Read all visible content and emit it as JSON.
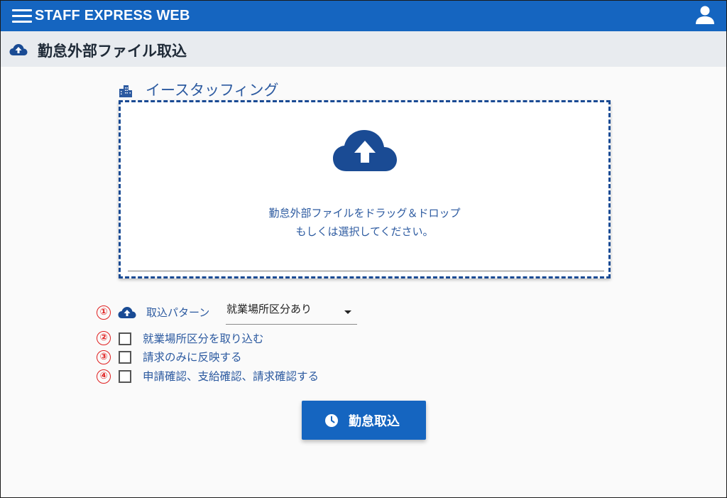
{
  "app": {
    "title": "STAFF EXPRESS WEB"
  },
  "page": {
    "title": "勤怠外部ファイル取込"
  },
  "company": {
    "name": "イースタッフィング"
  },
  "dropzone": {
    "line1": "勤怠外部ファイルをドラッグ＆ドロップ",
    "line2": "もしくは選択してください。"
  },
  "options": {
    "pattern": {
      "number": "①",
      "label": "取込パターン",
      "selected": "就業場所区分あり"
    },
    "checkboxes": [
      {
        "number": "②",
        "label": "就業場所区分を取り込む",
        "checked": false
      },
      {
        "number": "③",
        "label": "請求のみに反映する",
        "checked": false
      },
      {
        "number": "④",
        "label": "申請確認、支給確認、請求確認する",
        "checked": false
      }
    ]
  },
  "action": {
    "import_label": "勤怠取込"
  },
  "colors": {
    "primary": "#1565c0",
    "link_text": "#2c5aa0",
    "marker_red": "#e02020",
    "header_bg": "#e8ebef",
    "dropzone_border": "#1a4b94"
  },
  "icons": {
    "menu": "hamburger-menu-icon",
    "user": "user-icon",
    "page": "cloud-upload-icon",
    "company": "building-icon",
    "dropzone": "cloud-upload-icon",
    "pattern": "cloud-upload-icon",
    "select": "caret-down-icon",
    "import": "clock-icon"
  }
}
